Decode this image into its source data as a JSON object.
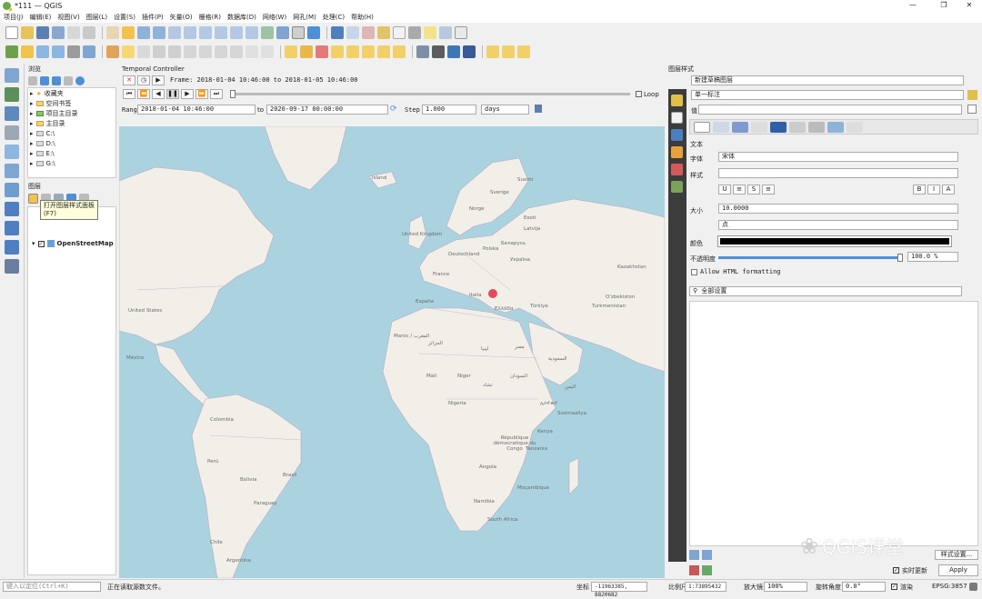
{
  "window": {
    "title": "*111 — QGIS",
    "min": "—",
    "max": "❐",
    "close": "✕"
  },
  "menu": [
    "项目(J)",
    "编辑(E)",
    "视图(V)",
    "图层(L)",
    "设置(S)",
    "插件(P)",
    "矢量(O)",
    "栅格(R)",
    "数据库(D)",
    "网络(W)",
    "网孔(M)",
    "处理(C)",
    "帮助(H)"
  ],
  "browser": {
    "title": "浏览",
    "items": [
      "收藏夹",
      "空间书签",
      "项目主目录",
      "主目录",
      "C:\\",
      "D:\\",
      "E:\\",
      "G:\\"
    ]
  },
  "layers": {
    "title": "图层",
    "tooltip_line1": "打开图层样式面板",
    "tooltip_line2": "(F7)",
    "items": [
      "OpenStreetMap"
    ]
  },
  "temporal": {
    "title": "Temporal Controller",
    "frame": "Frame: 2018-01-04 10:46:00 to 2018-01-05 10:46:00",
    "loop": "Loop",
    "range_label": "Range",
    "range_start": "2018-01-04 10:46:00",
    "to": "to",
    "range_end": "2020-09-17 00:00:00",
    "step_label": "Step",
    "step": "1.000",
    "unit": "days"
  },
  "map": {
    "labels": [
      "Island",
      "Suomi",
      "Sverige",
      "Norge",
      "Eesti",
      "Latvija",
      "Беларусь",
      "United Kingdom",
      "Deutschland",
      "Polska",
      "Україна",
      "France",
      "España",
      "Italia",
      "Ελλάδα",
      "Türkiye",
      "Kazakhstan",
      "O'zbekiston",
      "Turkmenistan",
      "United States",
      "México",
      "Maroc / المغرب",
      "الجزائر",
      "ليبيا",
      "مصر",
      "Mali",
      "Niger",
      "Nigeria",
      "تشاد",
      "السودان",
      "Soomaaliya",
      "Kenya",
      "République démocratique du Congo",
      "Tanzania",
      "Angola",
      "Moçambique",
      "Namibia",
      "South Africa",
      "Colombia",
      "Perú",
      "Brasil",
      "Bolivia",
      "Paraguay",
      "Argentina",
      "Chile",
      "السعودية",
      "ኢትዮጵያ",
      "اليمن"
    ]
  },
  "style": {
    "title": "图层样式",
    "layer": "新建草稿图层",
    "renderer": "单一标注",
    "value_label": "值",
    "text_label": "文本",
    "font_label": "字体",
    "font": "宋体",
    "style_label": "样式",
    "size_label": "大小",
    "size": "10.0000",
    "unit": "点",
    "color_label": "颜色",
    "opacity_label": "不透明度",
    "opacity": "100.0 %",
    "html": "Allow HTML formatting",
    "search": "全部设置",
    "live": "实时更新",
    "apply": "Apply",
    "history": "样式设置..."
  },
  "status": {
    "locator": "键入以定位(Ctrl+K)",
    "message": "正在读取源数文件。",
    "coord_label": "坐标",
    "coord": "-11963385, 8820682",
    "scale_label": "比例尺",
    "scale": "1:73895432",
    "mag_label": "放大镜",
    "mag": "100%",
    "rot_label": "旋转角度",
    "rot": "0.0°",
    "render": "渲染",
    "crs": "EPSG:3857"
  },
  "watermark": "QGIS课堂"
}
